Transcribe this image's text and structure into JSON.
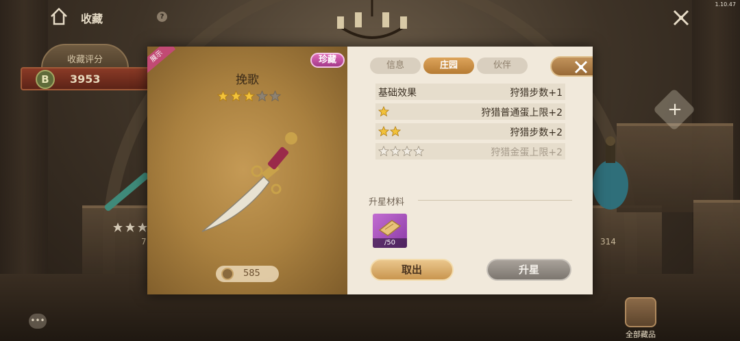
{
  "header": {
    "title": "收藏",
    "help_glyph": "?",
    "version": "1.10.47"
  },
  "score": {
    "title": "收藏评分",
    "grade": "B",
    "value": "3953"
  },
  "background": {
    "pedestal_left_count": "7",
    "pedestal_right_count": "314",
    "all_collections_label": "全部藏品",
    "chat_glyph": "•••",
    "plus_glyph": "+"
  },
  "item": {
    "showcase_tag": "展示",
    "rarity": "珍藏",
    "name": "挽歌",
    "stars_filled": 3,
    "stars_total": 5,
    "coin_value": "585"
  },
  "tabs": [
    {
      "label": "信息",
      "active": false
    },
    {
      "label": "庄园",
      "active": true
    },
    {
      "label": "伙伴",
      "active": false
    }
  ],
  "effects": [
    {
      "label": "基础效果",
      "stars": 0,
      "value": "狩猎步数+1",
      "dim": false
    },
    {
      "label": "",
      "stars": 1,
      "value": "狩猎普通蛋上限+2",
      "dim": false
    },
    {
      "label": "",
      "stars": 2,
      "value": "狩猎步数+2",
      "dim": false
    },
    {
      "label": "",
      "stars": 4,
      "value": "狩猎金蛋上限+2",
      "dim": true
    }
  ],
  "materials": {
    "title": "升星材料",
    "count": "/50"
  },
  "actions": {
    "withdraw": "取出",
    "upgrade": "升星"
  },
  "colors": {
    "accent": "#c9964f",
    "rarity": "#c24a9a",
    "star_gold": "#f2c23a",
    "star_empty": "#8d8272"
  }
}
